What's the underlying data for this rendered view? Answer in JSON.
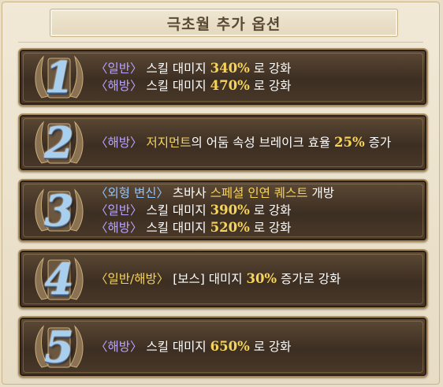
{
  "header": {
    "title": "극초월 추가 옵션"
  },
  "options": [
    {
      "numeral": "1",
      "lines": [
        {
          "tag": "〈일반〉",
          "text": "스킬 대미지",
          "value": "340%",
          "suffix": "로 강화"
        },
        {
          "tag": "〈해방〉",
          "text": "스킬 대미지",
          "value": "470%",
          "suffix": "로 강화"
        }
      ]
    },
    {
      "numeral": "2",
      "lines": [
        {
          "tag": "〈해방〉",
          "highlight": "저지먼트",
          "text": "의 어둠 속성 브레이크 효율",
          "value": "25%",
          "suffix": "증가"
        }
      ]
    },
    {
      "numeral": "3",
      "lines": [
        {
          "tag": "〈외형 변신〉",
          "text": "츠바사",
          "highlight": "스페셜 인연 퀘스트",
          "suffix": "개방"
        },
        {
          "tag": "〈일반〉",
          "text": "스킬 대미지",
          "value": "390%",
          "suffix": "로 강화"
        },
        {
          "tag": "〈해방〉",
          "text": "스킬 대미지",
          "value": "520%",
          "suffix": "로 강화"
        }
      ]
    },
    {
      "numeral": "4",
      "lines": [
        {
          "tag": "〈일반/해방〉",
          "text": "[보스] 대미지",
          "value": "30%",
          "suffix": "증가로 강화"
        }
      ]
    },
    {
      "numeral": "5",
      "lines": [
        {
          "tag": "〈해방〉",
          "text": "스킬 대미지",
          "value": "650%",
          "suffix": "로 강화"
        }
      ]
    }
  ],
  "colors": {
    "tag_purple": "#b9a4ff",
    "tag_blue": "#8fc3ff",
    "value_gold": "#f6d45a",
    "panel_brown": "#3c2e22",
    "numeral_blue": "#a9cfee"
  }
}
